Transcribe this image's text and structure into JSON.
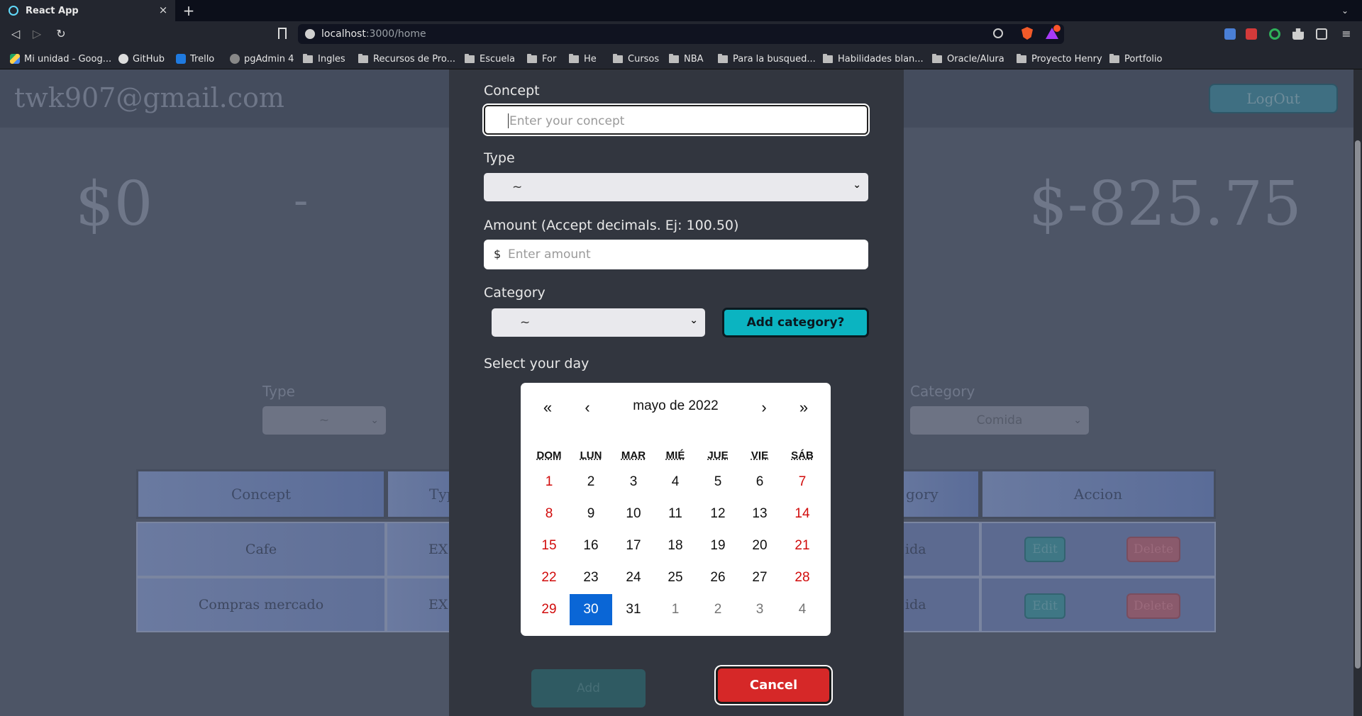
{
  "browser": {
    "tab_title": "React App",
    "tab_close": "×",
    "new_tab": "+",
    "tab_menu": "⌄",
    "url_host": "localhost",
    "url_path": ":3000/home",
    "nav": {
      "back": "◁",
      "forward": "▷",
      "reload": "↻"
    },
    "bookmarks": [
      {
        "label": "Mi unidad - Goog...",
        "icon": "google-drive-icon"
      },
      {
        "label": "GitHub",
        "icon": "github-icon"
      },
      {
        "label": "Trello",
        "icon": "trello-icon"
      },
      {
        "label": "pgAdmin 4",
        "icon": "globe-icon"
      },
      {
        "label": "Ingles",
        "icon": "folder-icon"
      },
      {
        "label": "Recursos de Pro...",
        "icon": "folder-icon"
      },
      {
        "label": "Escuela",
        "icon": "folder-icon"
      },
      {
        "label": "For",
        "icon": "folder-icon"
      },
      {
        "label": "He",
        "icon": "folder-icon"
      },
      {
        "label": "Cursos",
        "icon": "folder-icon"
      },
      {
        "label": "NBA",
        "icon": "folder-icon"
      },
      {
        "label": "Para la busqued...",
        "icon": "folder-icon"
      },
      {
        "label": "Habilidades blan...",
        "icon": "folder-icon"
      },
      {
        "label": "Oracle/Alura",
        "icon": "folder-icon"
      },
      {
        "label": "Proyecto Henry",
        "icon": "folder-icon"
      },
      {
        "label": "Portfolio",
        "icon": "folder-icon"
      }
    ]
  },
  "page": {
    "user_email": "twk907@gmail.com",
    "logout_label": "LogOut",
    "balance_left": "$0",
    "balance_dash": "-",
    "balance_right": "$-825.75",
    "filter_type_label": "Type",
    "filter_type_value": "~",
    "filter_category_label": "Category",
    "filter_category_value": "Comida",
    "table": {
      "headers": [
        "Concept",
        "Typ",
        "gory",
        "Accion"
      ],
      "rows": [
        {
          "concept": "Cafe",
          "type": "EX",
          "category": "ida",
          "edit": "Edit",
          "delete": "Delete"
        },
        {
          "concept": "Compras mercado",
          "type": "EX",
          "category": "ida",
          "edit": "Edit",
          "delete": "Delete"
        }
      ]
    }
  },
  "modal": {
    "concept_label": "Concept",
    "concept_placeholder": "Enter your concept",
    "type_label": "Type",
    "type_value": "~",
    "amount_label": "Amount (Accept decimals. Ej: 100.50)",
    "amount_prefix": "$",
    "amount_placeholder": "Enter amount",
    "category_label": "Category",
    "category_value": "~",
    "add_category_label": "Add category?",
    "day_label": "Select your day",
    "add_label": "Add",
    "cancel_label": "Cancel",
    "calendar": {
      "title": "mayo de 2022",
      "prev_year": "«",
      "prev_month": "‹",
      "next_month": "›",
      "next_year": "»",
      "weekdays": [
        "DOM",
        "LUN",
        "MAR",
        "MIÉ",
        "JUE",
        "VIE",
        "SÁB"
      ],
      "weeks": [
        [
          "1",
          "2",
          "3",
          "4",
          "5",
          "6",
          "7"
        ],
        [
          "8",
          "9",
          "10",
          "11",
          "12",
          "13",
          "14"
        ],
        [
          "15",
          "16",
          "17",
          "18",
          "19",
          "20",
          "21"
        ],
        [
          "22",
          "23",
          "24",
          "25",
          "26",
          "27",
          "28"
        ],
        [
          "29",
          "30",
          "31",
          "1",
          "2",
          "3",
          "4"
        ]
      ],
      "selected_day": "30"
    }
  }
}
